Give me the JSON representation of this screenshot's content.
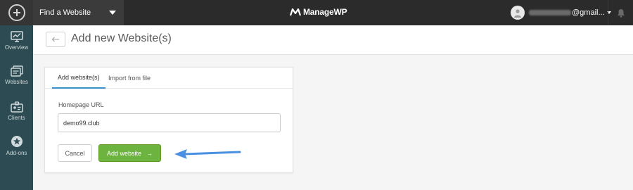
{
  "topbar": {
    "add_icon": "plus-circle-icon",
    "site_selector": {
      "label": "Find a Website"
    },
    "logo": {
      "text": "ManageWP"
    },
    "account": {
      "email_suffix": "@gmail..."
    },
    "notifications_icon": "bell-icon"
  },
  "sidebar": {
    "items": [
      {
        "label": "Overview",
        "icon": "monitor-icon"
      },
      {
        "label": "Websites",
        "icon": "websites-icon"
      },
      {
        "label": "Clients",
        "icon": "clients-icon"
      },
      {
        "label": "Add-ons",
        "icon": "addons-icon"
      }
    ]
  },
  "header": {
    "back_icon": "back-arrow-icon",
    "title": "Add new Website(s)"
  },
  "form": {
    "tabs": [
      {
        "label": "Add website(s)",
        "active": true
      },
      {
        "label": "Import from file",
        "active": false
      }
    ],
    "homepage_url_label": "Homepage URL",
    "homepage_url_value": "demo99.club",
    "cancel_label": "Cancel",
    "submit_label": "Add website",
    "submit_arrow": "→"
  },
  "colors": {
    "topbar_bg": "#2b2b2b",
    "sidebar_bg": "#2d4b52",
    "primary_green": "#6db33f",
    "tab_underline": "#3d8fc9",
    "annotation_arrow": "#4a90e2"
  }
}
